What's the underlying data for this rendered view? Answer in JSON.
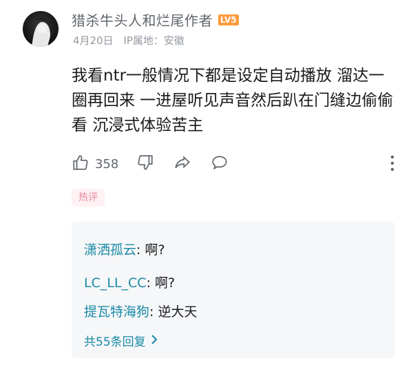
{
  "comment": {
    "username": "猎杀牛头人和烂尾作者",
    "level": "LV5",
    "date": "4月20日",
    "ip_location": "IP属地：安徽",
    "text": "我看ntr一般情况下都是设定自动播放 溜达一圈再回来 一进屋听见声音然后趴在门缝边偷偷看 沉浸式体验苦主",
    "like_count": "358",
    "tag": "热评"
  },
  "replies": [
    {
      "name": "潇洒孤云",
      "sep": ": ",
      "text": "啊?"
    },
    {
      "name": "LC_LL_CC",
      "sep": ": ",
      "text": "啊?"
    },
    {
      "name": "提瓦特海狗",
      "sep": ": ",
      "text": "逆大天"
    }
  ],
  "reply_more": "共55条回复",
  "icons": {
    "like": "thumbs-up-icon",
    "dislike": "thumbs-down-icon",
    "share": "share-icon",
    "reply": "comment-icon",
    "more": "more-vertical-icon",
    "expand": "chevron-right-icon"
  },
  "colors": {
    "level_badge": "#ff9b3d",
    "reply_name": "#1a8aa8",
    "hot_tag_text": "#e5899d",
    "hot_tag_bg": "#fff1f4"
  }
}
